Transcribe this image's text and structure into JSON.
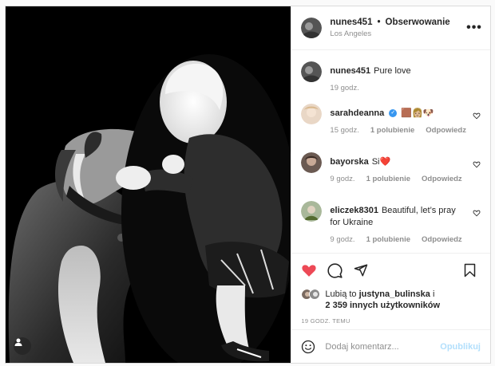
{
  "post": {
    "username": "nunes451",
    "separator": "•",
    "follow_label": "Obserwowanie",
    "location": "Los Angeles",
    "more_label": "•••"
  },
  "caption": {
    "username": "nunes451",
    "text": "Pure love",
    "time": "19 godz."
  },
  "comments": [
    {
      "username": "sarahdeanna",
      "text": "",
      "emoji_text": "🟫👩🏼🐶",
      "time": "15 godz.",
      "likes": "1 polubienie",
      "reply": "Odpowiedz",
      "verified": true
    },
    {
      "username": "bayorska",
      "text": "Si❤️",
      "time": "9 godz.",
      "likes": "1 polubienie",
      "reply": "Odpowiedz"
    },
    {
      "username": "eliczek8301",
      "text": "Beautiful, let’s pray for Ukraine",
      "time": "9 godz.",
      "likes": "1 polubienie",
      "reply": "Odpowiedz"
    }
  ],
  "likes": {
    "prefix": "Lubią to",
    "user": "justyna_bulinska",
    "connector": "i",
    "others": "2 359 innych użytkowników"
  },
  "timestamp": "19 GODZ. TEMU",
  "add_comment": {
    "placeholder": "Dodaj komentarz...",
    "publish_label": "Opublikuj"
  },
  "colors": {
    "like_red": "#ed4956",
    "link_blue": "#3897f0",
    "publish_disabled": "#b2dffc"
  },
  "icons": [
    "heart-icon",
    "comment-icon",
    "share-icon",
    "bookmark-icon",
    "emoji-icon",
    "tag-user-icon",
    "more-icon",
    "verified-icon"
  ]
}
